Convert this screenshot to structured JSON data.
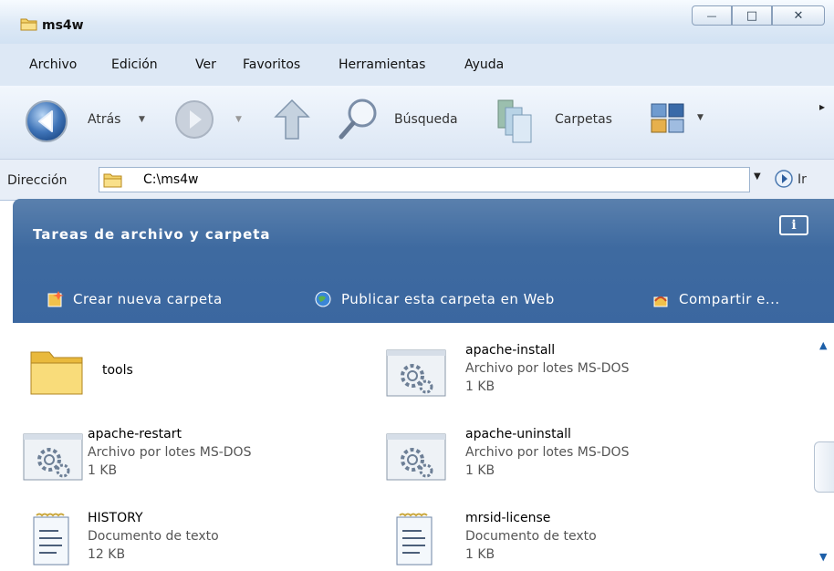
{
  "window": {
    "title": "ms4w",
    "minimize_glyph": "—",
    "maximize_glyph": "□",
    "close_glyph": "✕"
  },
  "menu": [
    {
      "label": "Archivo"
    },
    {
      "label": "Edición"
    },
    {
      "label": "Ver"
    },
    {
      "label": "Favoritos"
    },
    {
      "label": "Herramientas"
    },
    {
      "label": "Ayuda"
    }
  ],
  "toolbar": {
    "back_label": "Atrás",
    "search_label": "Búsqueda",
    "folders_label": "Carpetas",
    "more_glyph": "▸"
  },
  "address": {
    "label": "Dirección",
    "path": "C:\\ms4w",
    "go_label": "Ir"
  },
  "taskpane": {
    "title": "Tareas de archivo y carpeta",
    "info_glyph": "i",
    "links": [
      {
        "label": "Crear nueva carpeta"
      },
      {
        "label": "Publicar esta carpeta en Web"
      },
      {
        "label": "Compartir e..."
      }
    ]
  },
  "files": [
    {
      "name": "tools",
      "type": "",
      "size": "",
      "icon": "folder-icon"
    },
    {
      "name": "apache-install",
      "type": "Archivo por lotes MS-DOS",
      "size": "1 KB",
      "icon": "batch-file-icon"
    },
    {
      "name": "apache-restart",
      "type": "Archivo por lotes MS-DOS",
      "size": "1 KB",
      "icon": "batch-file-icon"
    },
    {
      "name": "apache-uninstall",
      "type": "Archivo por lotes MS-DOS",
      "size": "1 KB",
      "icon": "batch-file-icon"
    },
    {
      "name": "HISTORY",
      "type": "Documento de texto",
      "size": "12 KB",
      "icon": "text-document-icon"
    },
    {
      "name": "mrsid-license",
      "type": "Documento de texto",
      "size": "1 KB",
      "icon": "text-document-icon"
    }
  ],
  "colors": {
    "taskpane": "#3e6aa0",
    "titlebar": "#dde9f6"
  }
}
